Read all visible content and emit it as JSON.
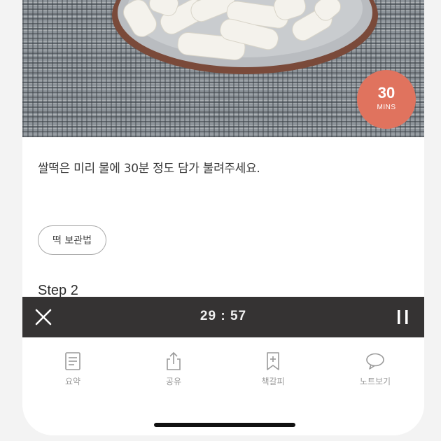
{
  "recipe": {
    "time_badge": {
      "number": "30",
      "unit": "MINS"
    },
    "instruction": "쌀떡은 미리 물에 30분 정도 담가 불려주세요.",
    "tag_button": "떡 보관법",
    "next_step_title": "Step 2"
  },
  "timer": {
    "display": "29 : 57",
    "close_icon": "close-icon",
    "pause_icon": "pause-icon"
  },
  "bottom_nav": {
    "items": [
      {
        "label": "요약",
        "icon": "summary-document-icon"
      },
      {
        "label": "공유",
        "icon": "share-icon"
      },
      {
        "label": "책갈피",
        "icon": "bookmark-add-icon"
      },
      {
        "label": "노트보기",
        "icon": "speech-bubble-icon"
      }
    ]
  },
  "colors": {
    "accent": "#e0735e",
    "timer_bar": "#353333",
    "nav_icon": "#9a9a9a"
  }
}
